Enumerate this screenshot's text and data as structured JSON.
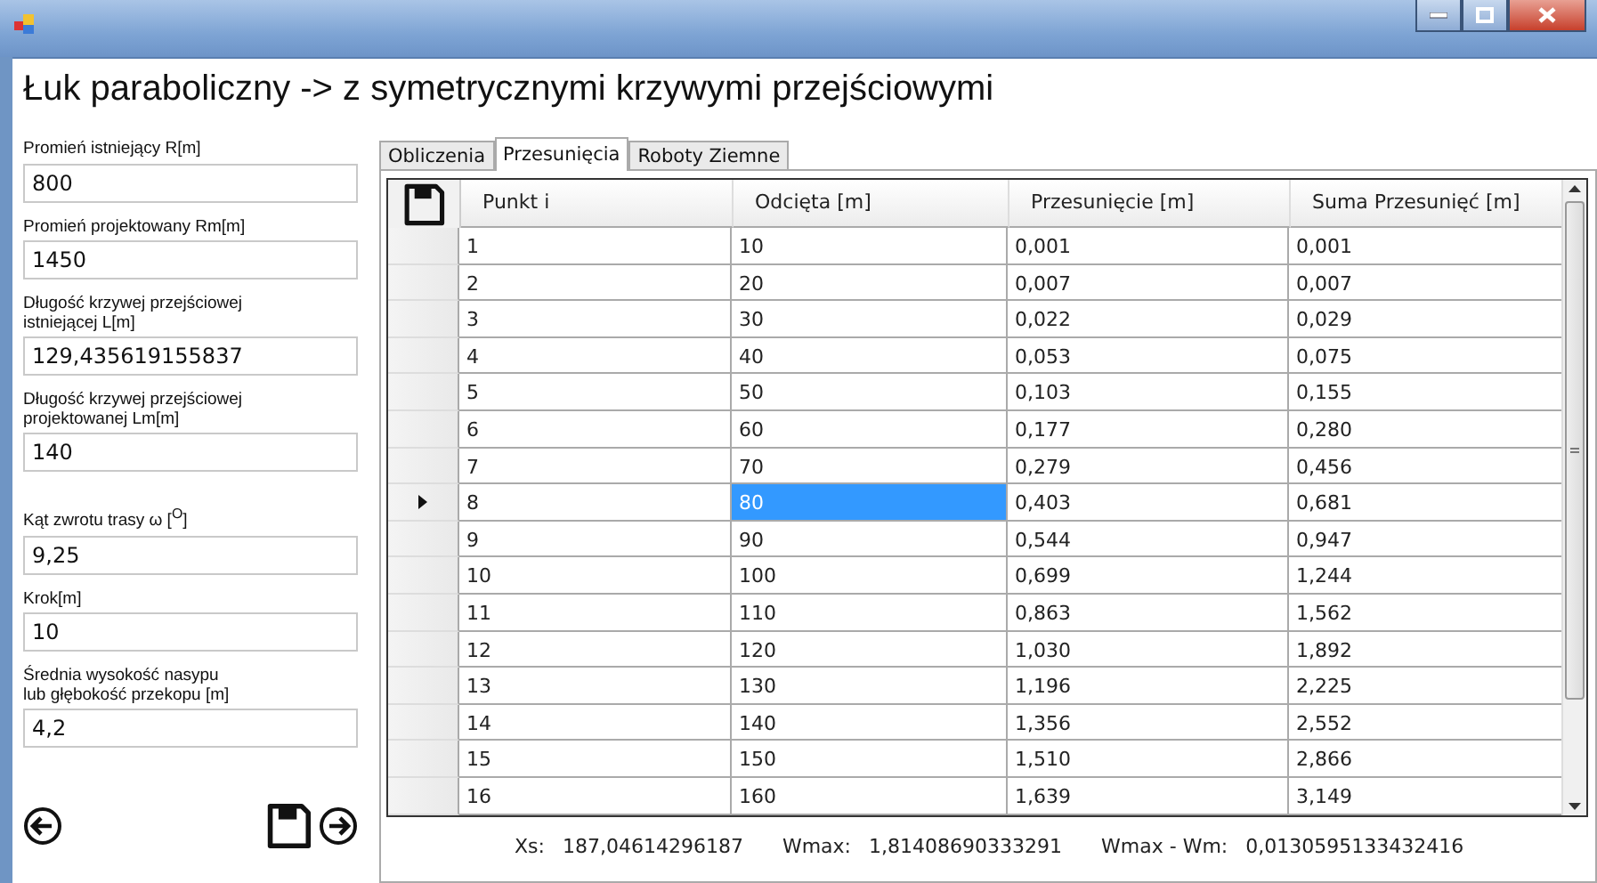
{
  "window": {
    "heading": "Łuk paraboliczny -> z symetrycznymi krzywymi przejściowymi"
  },
  "field_groups": [
    [
      {
        "label": "Promień istniejący R[m]",
        "value": "800"
      },
      {
        "label": "Promień projektowany Rm[m]",
        "value": "1450"
      },
      {
        "label": "Długość krzywej przejściowej\nistniejącej L[m]",
        "value": "129,435619155837"
      },
      {
        "label": "Długość krzywej przejściowej\nprojektowanej Lm[m]",
        "value": "140"
      }
    ],
    [
      {
        "label": "Kąt zwrotu trasy ω  [$^{O}$]",
        "value": "9,25"
      },
      {
        "label": "Krok[m]",
        "value": "10"
      },
      {
        "label": "Średnia wysokość nasypu\nlub głębokość przekopu [m]",
        "value": "4,2"
      }
    ]
  ],
  "tabs": [
    {
      "label": "Obliczenia",
      "selected": false
    },
    {
      "label": "Przesunięcia",
      "selected": true
    },
    {
      "label": "Roboty Ziemne",
      "selected": false
    }
  ],
  "table": {
    "columns": [
      "Punkt i",
      "Odcięta [m]",
      "Przesunięcie [m]",
      "Suma Przesunięć [m]"
    ],
    "rows": [
      {
        "current": false,
        "cells": [
          {
            "text": "1",
            "selected": false
          },
          {
            "text": "10",
            "selected": false
          },
          {
            "text": "0,001",
            "selected": false
          },
          {
            "text": "0,001",
            "selected": false
          }
        ]
      },
      {
        "current": false,
        "cells": [
          {
            "text": "2",
            "selected": false
          },
          {
            "text": "20",
            "selected": false
          },
          {
            "text": "0,007",
            "selected": false
          },
          {
            "text": "0,007",
            "selected": false
          }
        ]
      },
      {
        "current": false,
        "cells": [
          {
            "text": "3",
            "selected": false
          },
          {
            "text": "30",
            "selected": false
          },
          {
            "text": "0,022",
            "selected": false
          },
          {
            "text": "0,029",
            "selected": false
          }
        ]
      },
      {
        "current": false,
        "cells": [
          {
            "text": "4",
            "selected": false
          },
          {
            "text": "40",
            "selected": false
          },
          {
            "text": "0,053",
            "selected": false
          },
          {
            "text": "0,075",
            "selected": false
          }
        ]
      },
      {
        "current": false,
        "cells": [
          {
            "text": "5",
            "selected": false
          },
          {
            "text": "50",
            "selected": false
          },
          {
            "text": "0,103",
            "selected": false
          },
          {
            "text": "0,155",
            "selected": false
          }
        ]
      },
      {
        "current": false,
        "cells": [
          {
            "text": "6",
            "selected": false
          },
          {
            "text": "60",
            "selected": false
          },
          {
            "text": "0,177",
            "selected": false
          },
          {
            "text": "0,280",
            "selected": false
          }
        ]
      },
      {
        "current": false,
        "cells": [
          {
            "text": "7",
            "selected": false
          },
          {
            "text": "70",
            "selected": false
          },
          {
            "text": "0,279",
            "selected": false
          },
          {
            "text": "0,456",
            "selected": false
          }
        ]
      },
      {
        "current": true,
        "cells": [
          {
            "text": "8",
            "selected": false
          },
          {
            "text": "80",
            "selected": true
          },
          {
            "text": "0,403",
            "selected": false
          },
          {
            "text": "0,681",
            "selected": false
          }
        ]
      },
      {
        "current": false,
        "cells": [
          {
            "text": "9",
            "selected": false
          },
          {
            "text": "90",
            "selected": false
          },
          {
            "text": "0,544",
            "selected": false
          },
          {
            "text": "0,947",
            "selected": false
          }
        ]
      },
      {
        "current": false,
        "cells": [
          {
            "text": "10",
            "selected": false
          },
          {
            "text": "100",
            "selected": false
          },
          {
            "text": "0,699",
            "selected": false
          },
          {
            "text": "1,244",
            "selected": false
          }
        ]
      },
      {
        "current": false,
        "cells": [
          {
            "text": "11",
            "selected": false
          },
          {
            "text": "110",
            "selected": false
          },
          {
            "text": "0,863",
            "selected": false
          },
          {
            "text": "1,562",
            "selected": false
          }
        ]
      },
      {
        "current": false,
        "cells": [
          {
            "text": "12",
            "selected": false
          },
          {
            "text": "120",
            "selected": false
          },
          {
            "text": "1,030",
            "selected": false
          },
          {
            "text": "1,892",
            "selected": false
          }
        ]
      },
      {
        "current": false,
        "cells": [
          {
            "text": "13",
            "selected": false
          },
          {
            "text": "130",
            "selected": false
          },
          {
            "text": "1,196",
            "selected": false
          },
          {
            "text": "2,225",
            "selected": false
          }
        ]
      },
      {
        "current": false,
        "cells": [
          {
            "text": "14",
            "selected": false
          },
          {
            "text": "140",
            "selected": false
          },
          {
            "text": "1,356",
            "selected": false
          },
          {
            "text": "2,552",
            "selected": false
          }
        ]
      },
      {
        "current": false,
        "cells": [
          {
            "text": "15",
            "selected": false
          },
          {
            "text": "150",
            "selected": false
          },
          {
            "text": "1,510",
            "selected": false
          },
          {
            "text": "2,866",
            "selected": false
          }
        ]
      },
      {
        "current": false,
        "cells": [
          {
            "text": "16",
            "selected": false
          },
          {
            "text": "160",
            "selected": false
          },
          {
            "text": "1,639",
            "selected": false
          },
          {
            "text": "3,149",
            "selected": false
          }
        ]
      }
    ]
  },
  "summary": [
    {
      "label": "Xs:",
      "value": "187,04614296187"
    },
    {
      "label": "Wmax:",
      "value": "1,81408690333291"
    },
    {
      "label": "Wmax - Wm:",
      "value": "0,0130595133432416"
    }
  ]
}
